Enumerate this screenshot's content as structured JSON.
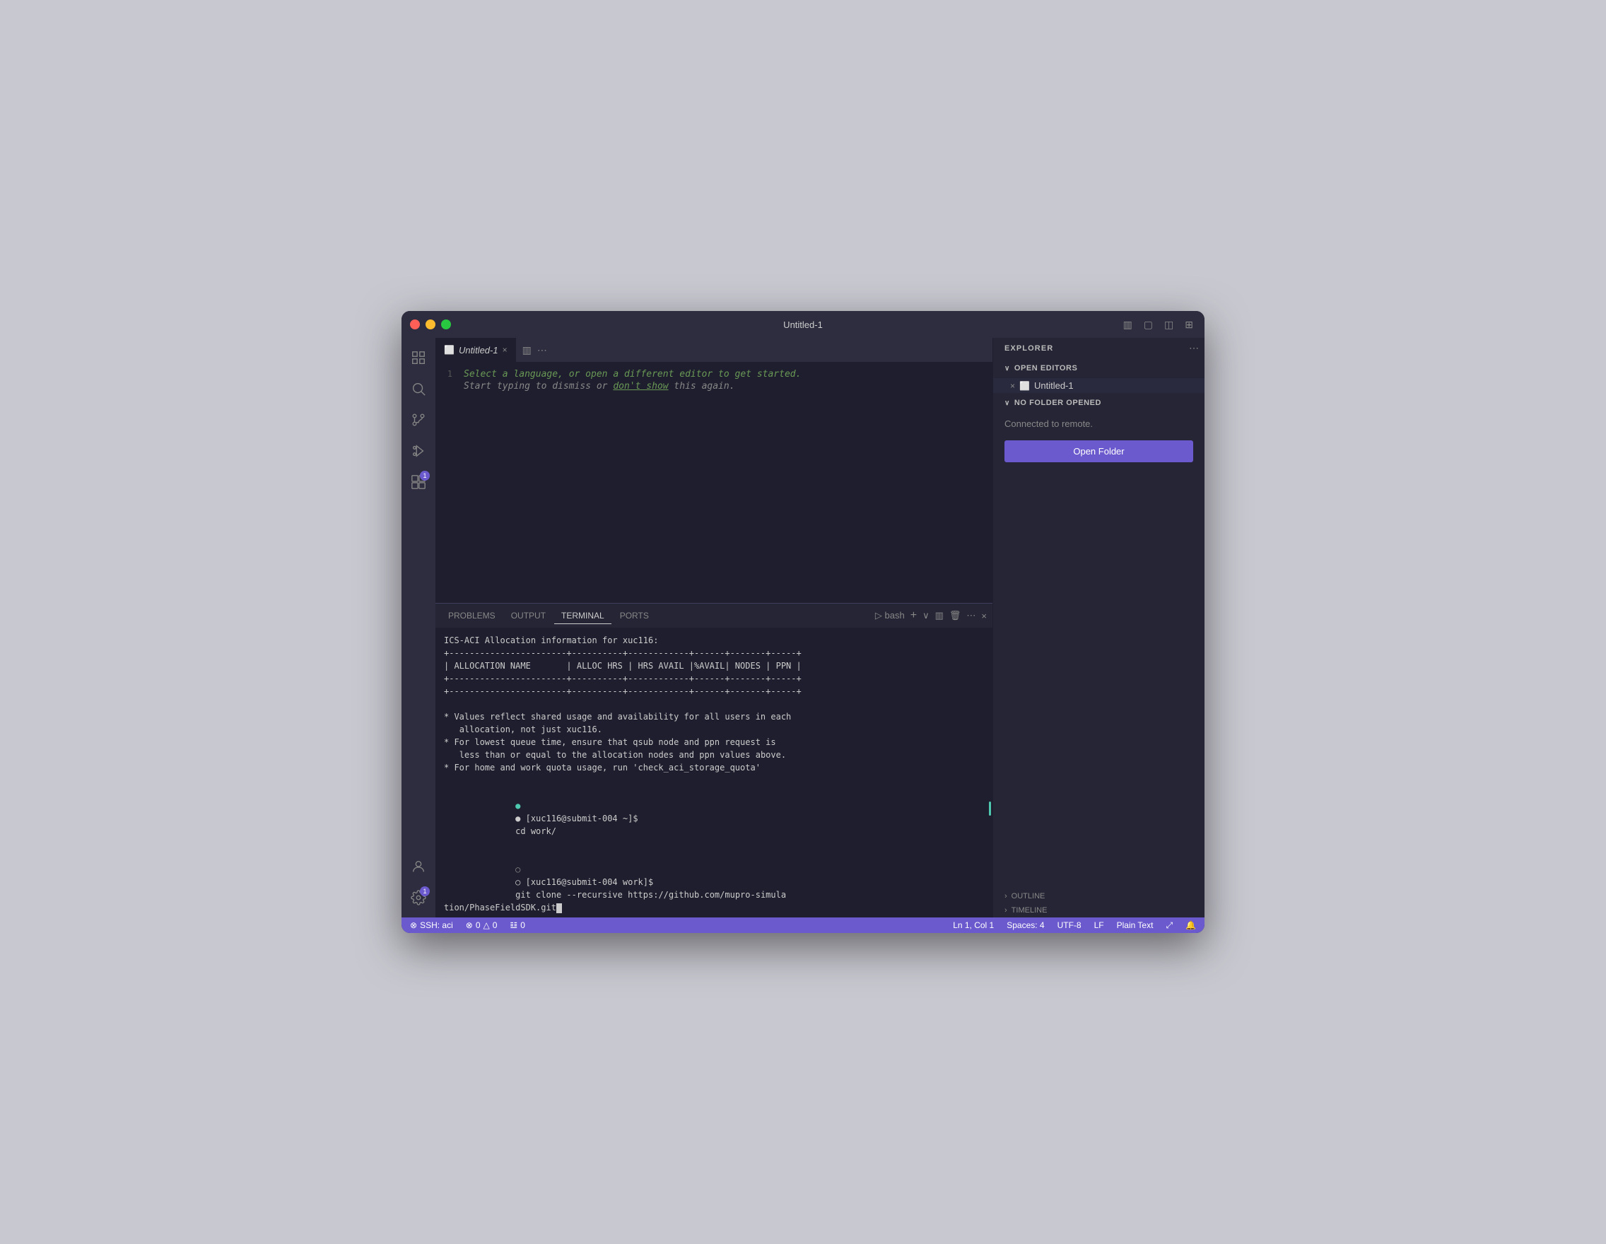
{
  "window": {
    "title": "Untitled-1",
    "traffic_lights": [
      "red",
      "yellow",
      "green"
    ]
  },
  "titlebar": {
    "title": "Untitled-1",
    "right_icons": [
      "layout-icon",
      "maximize-icon",
      "sidebar-icon",
      "grid-icon"
    ]
  },
  "activity_bar": {
    "icons": [
      {
        "name": "explorer-icon",
        "symbol": "⎘",
        "active": false
      },
      {
        "name": "search-icon",
        "symbol": "🔍",
        "active": false
      },
      {
        "name": "source-control-icon",
        "symbol": "⑂",
        "active": false
      },
      {
        "name": "debug-icon",
        "symbol": "▷",
        "active": false
      },
      {
        "name": "extensions-icon",
        "symbol": "⊞",
        "badge": "1",
        "active": false
      }
    ],
    "bottom_icons": [
      {
        "name": "remote-icon",
        "symbol": "👤"
      },
      {
        "name": "settings-icon",
        "symbol": "⚙",
        "badge": "1"
      }
    ]
  },
  "editor": {
    "tab_label": "Untitled-1",
    "hint_line1": "Select a language, or open a different editor to get started.",
    "hint_line2_prefix": "Start typing to dismiss or ",
    "hint_line2_link": "don't show",
    "hint_line2_suffix": " this again.",
    "line_number": "1"
  },
  "terminal": {
    "tabs": [
      {
        "label": "PROBLEMS",
        "active": false
      },
      {
        "label": "OUTPUT",
        "active": false
      },
      {
        "label": "TERMINAL",
        "active": true
      },
      {
        "label": "PORTS",
        "active": false
      }
    ],
    "shell_label": "bash",
    "actions": [
      "+",
      "⋯",
      "×"
    ],
    "lines": [
      "ICS-ACI Allocation information for xuc116:",
      "+-----------------------+----------+------------+------+-------+-----+",
      "| ALLOCATION NAME       | ALLOC HRS | HRS AVAIL |%AVAIL| NODES | PPN |",
      "+-----------------------+----------+------------+------+-------+-----+",
      "+-----------------------+----------+------------+------+-------+-----+",
      "",
      "* Values reflect shared usage and availability for all users in each",
      "   allocation, not just xuc116.",
      "* For lowest queue time, ensure that qsub node and ppn request is",
      "   less than or equal to the allocation nodes and ppn values above.",
      "* For home and work quota usage, run 'check_aci_storage_quota'",
      ""
    ],
    "prompt1_prefix": "● [xuc116@submit-004 ~]$ ",
    "prompt1_cmd": "cd work/",
    "prompt2_prefix": "○ [xuc116@submit-004 work]$ ",
    "prompt2_cmd": "git clone --recursive https://github.com/mupro-simula\ntion/PhaseFieldSDK.git"
  },
  "sidebar": {
    "title": "EXPLORER",
    "open_editors_label": "OPEN EDITORS",
    "no_folder_label": "NO FOLDER OPENED",
    "connected_text": "Connected to remote.",
    "open_folder_btn": "Open Folder",
    "outline_label": "OUTLINE",
    "timeline_label": "TIMELINE",
    "file_name": "Untitled-1"
  },
  "status_bar": {
    "ssh_label": "SSH: aci",
    "errors": "0",
    "warnings": "0",
    "remote": "0",
    "position": "Ln 1, Col 1",
    "spaces": "Spaces: 4",
    "encoding": "UTF-8",
    "eol": "LF",
    "language": "Plain Text"
  }
}
